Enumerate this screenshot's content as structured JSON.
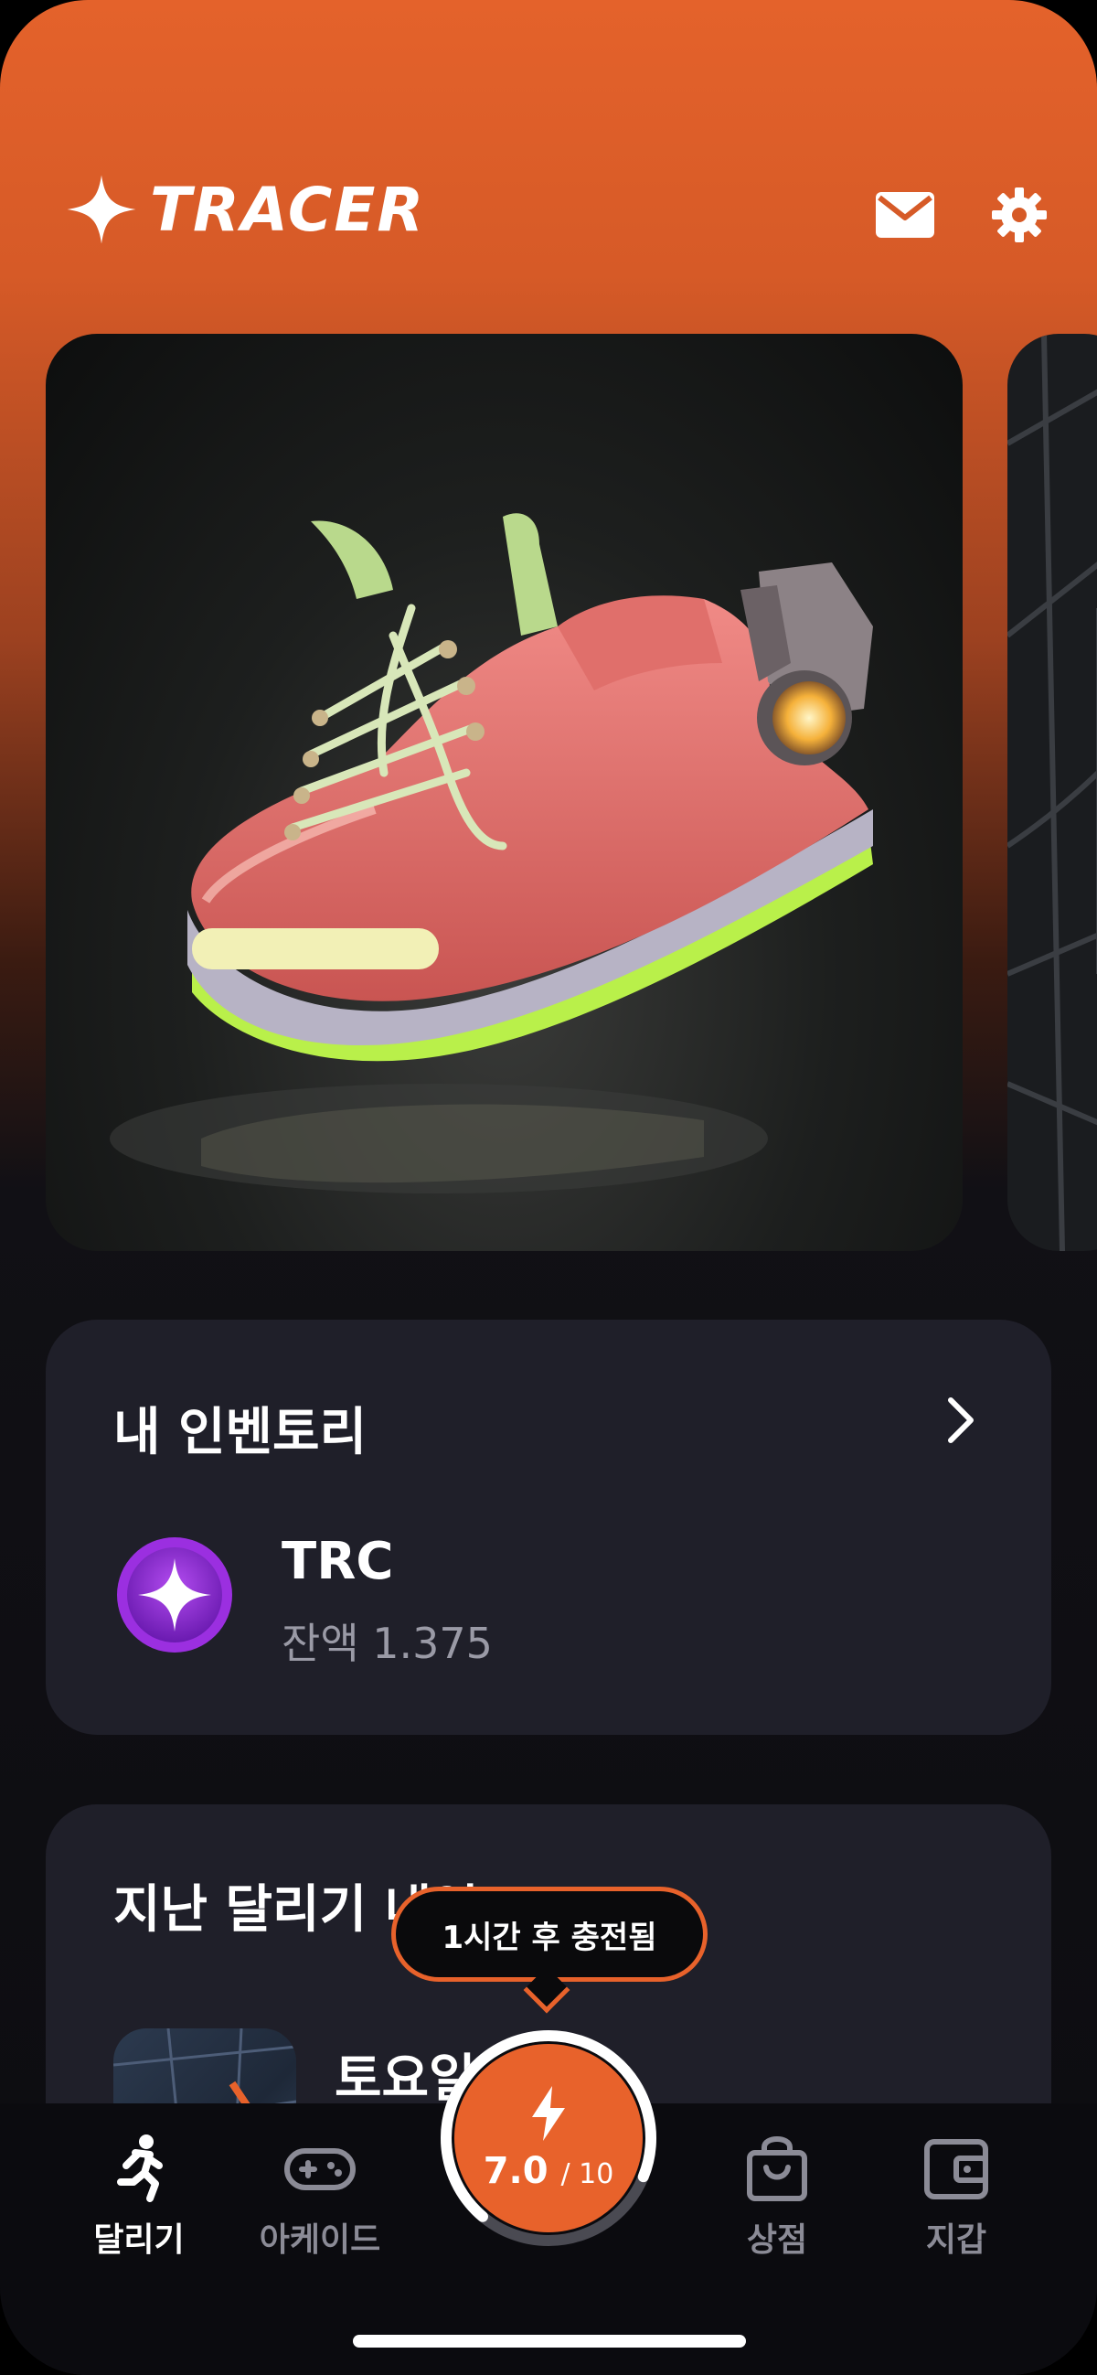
{
  "header": {
    "logo_text": "TRACER",
    "mail_icon": "mail-icon",
    "settings_icon": "gear-icon"
  },
  "carousel": {
    "main_item": "sneaker-image"
  },
  "inventory": {
    "title": "내 인벤토리",
    "token": {
      "name": "TRC",
      "balance": "잔액 1.375"
    }
  },
  "runs": {
    "title": "지난 달리기 내역",
    "items": [
      {
        "title": "토요일 러닝"
      }
    ]
  },
  "tooltip": {
    "text": "1시간 후 충전됨"
  },
  "energy": {
    "value": "7.0",
    "max": "/ 10",
    "fraction": 0.7
  },
  "nav": {
    "items": [
      {
        "label": "달리기",
        "icon": "runner-icon"
      },
      {
        "label": "아케이드",
        "icon": "gamepad-icon"
      },
      {
        "label": "상점",
        "icon": "shopping-bag-icon"
      },
      {
        "label": "지갑",
        "icon": "wallet-icon"
      }
    ]
  },
  "colors": {
    "accent": "#e8622b",
    "panel": "#1f1f29",
    "background": "#0c0c10"
  }
}
